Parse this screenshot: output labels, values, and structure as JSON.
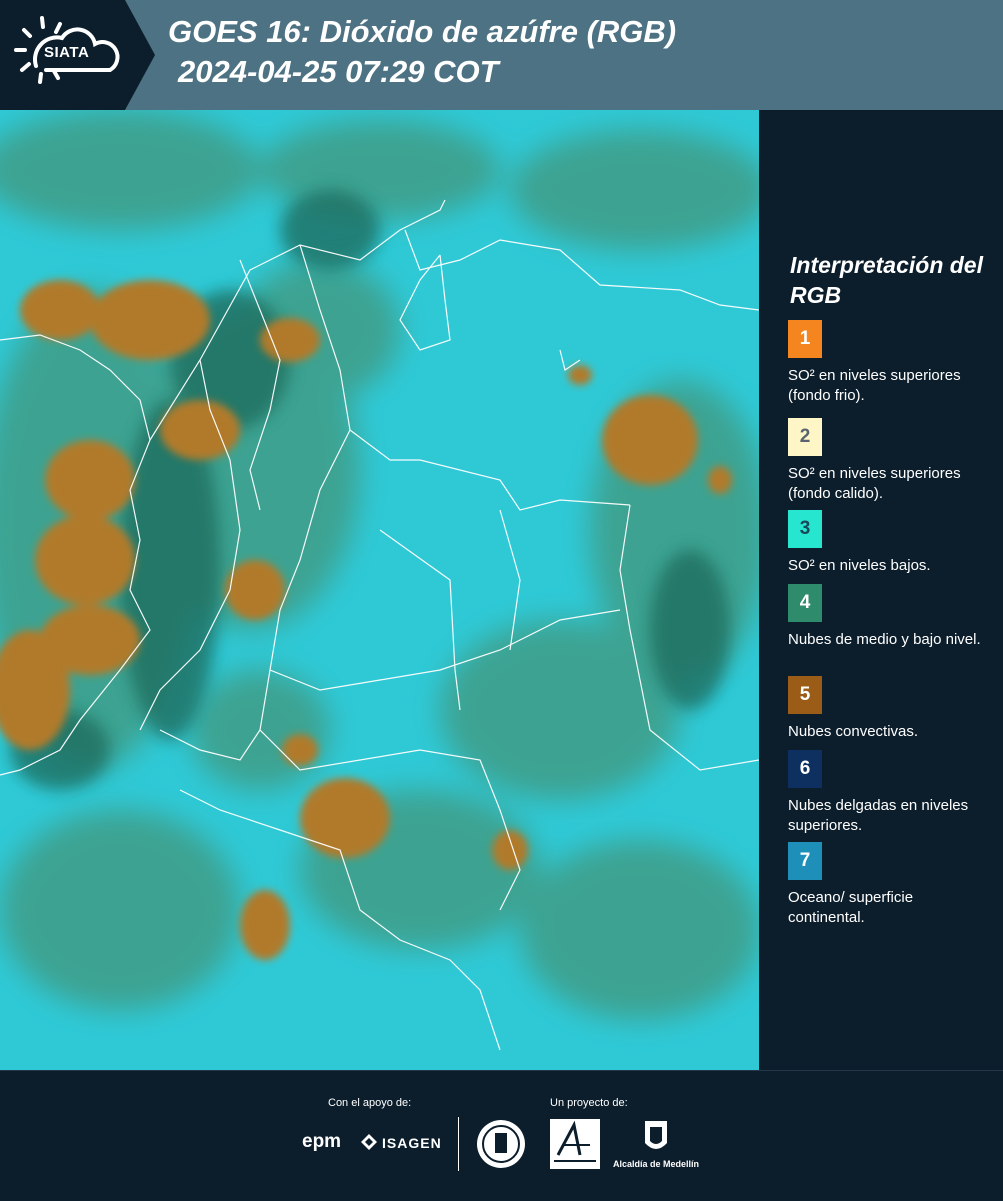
{
  "header": {
    "logo_text": "SIATA",
    "title_line1": "GOES 16: Dióxido de azúfre (RGB)",
    "title_line2": "2024-04-25 07:29 COT"
  },
  "map": {
    "icon": "satellite-composite-map"
  },
  "legend": {
    "title": "Interpretación del RGB",
    "items": [
      {
        "number": "1",
        "color": "#f5861f",
        "text_color": "#ffffff",
        "label": "SO² en niveles superiores (fondo frio)."
      },
      {
        "number": "2",
        "color": "#fff6c7",
        "text_color": "#5a6470",
        "label": "SO² en niveles superiores (fondo calido)."
      },
      {
        "number": "3",
        "color": "#26e6cf",
        "text_color": "#16485a",
        "label": "SO² en niveles bajos."
      },
      {
        "number": "4",
        "color": "#2e8b6b",
        "text_color": "#ffffff",
        "label": "Nubes de medio y bajo nivel."
      },
      {
        "number": "5",
        "color": "#9a5c17",
        "text_color": "#ffffff",
        "label": "Nubes convectivas."
      },
      {
        "number": "6",
        "color": "#0e3061",
        "text_color": "#ffffff",
        "label": "Nubes delgadas en niveles superiores."
      },
      {
        "number": "7",
        "color": "#1d8fb9",
        "text_color": "#ffffff",
        "label": "Oceano/ superficie continental."
      }
    ]
  },
  "footer": {
    "support_label": "Con el apoyo de:",
    "project_label": "Un proyecto de:",
    "epm_text": "epm",
    "isagen_text": "ISAGEN",
    "alcaldia_text": "Alcaldía de Medellín"
  }
}
